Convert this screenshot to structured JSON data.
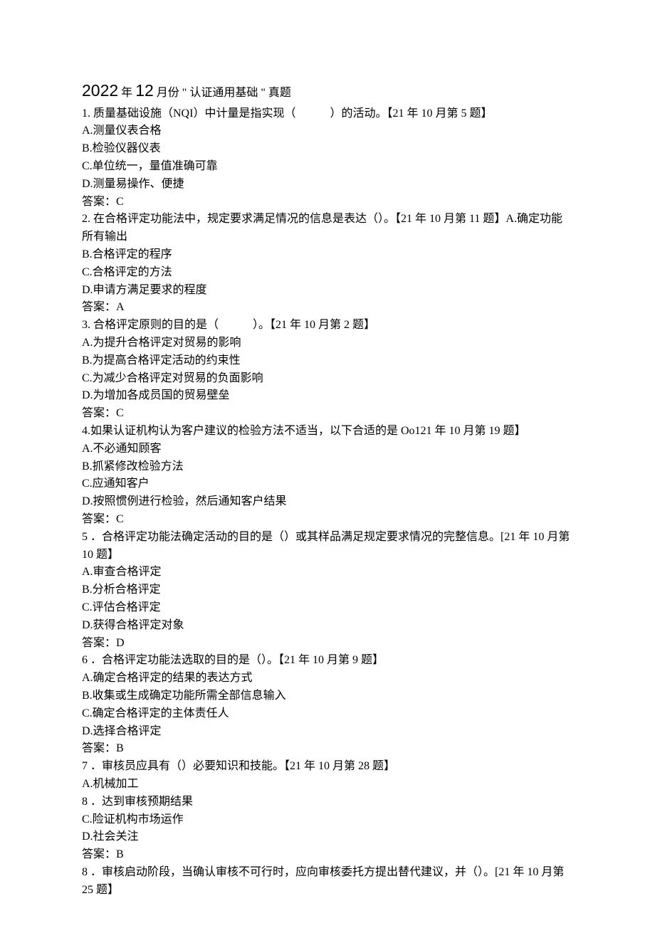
{
  "title": {
    "year": "2022",
    "year_suffix": " 年 ",
    "month": "12",
    "month_suffix": " 月份 \" 认证通用基础 \" 真题"
  },
  "questions": [
    {
      "stem": "1. 质量基础设施（NQI）中计量是指实现（　　　）的活动。【21 年 10 月第 5 题】",
      "options": [
        "A.测量仪表合格",
        "B.检验仪器仪表",
        "C.单位统一，量值准确可靠",
        "D.测量易操作、便捷"
      ],
      "answer": "答案：C"
    },
    {
      "stem": "2. 在合格评定功能法中，规定要求满足情况的信息是表达（）。【21 年 10 月第 11 题】A.确定功能所有输出",
      "options": [
        "B.合格评定的程序",
        "C.合格评定的方法",
        "D.申请方满足要求的程度"
      ],
      "answer": "答案：A"
    },
    {
      "stem": "3. 合格评定原则的目的是（　　　）。【21 年 10 月第 2 题】",
      "options": [
        "A.为提升合格评定对贸易的影响",
        "B.为提高合格评定活动的约束性",
        "C.为减少合格评定对贸易的负面影响",
        "D.为增加各成员国的贸易壁垒"
      ],
      "answer": "答案：C"
    },
    {
      "stem": "4.如果认证机构认为客户建议的检验方法不适当，以下合适的是 Oo121 年 10 月第 19 题】",
      "options": [
        "A.不必通知顾客",
        "B.抓紧修改检验方法",
        "C.应通知客户",
        "D.按照惯例进行检验，然后通知客户结果"
      ],
      "answer": "答案：C"
    },
    {
      "stem": "5 ．合格评定功能法确定活动的目的是（）或其样品满足规定要求情况的完整信息。[21 年 10 月第 10 题】",
      "options": [
        "A.审查合格评定",
        "B.分析合格评定",
        "C.评估合格评定",
        "D.获得合格评定对象"
      ],
      "answer": "答案：D"
    },
    {
      "stem": "6 ．合格评定功能法选取的目的是（）。【21 年 10 月第 9 题】",
      "options": [
        "A.确定合格评定的结果的表达方式",
        "B.收集或生成确定功能所需全部信息输入",
        "C.确定合格评定的主体责任人",
        "D.选择合格评定"
      ],
      "answer": "答案：B"
    },
    {
      "stem": "7 ．审核员应具有（）必要知识和技能。【21 年 10 月第 28 题】",
      "options": [
        "A.机械加工",
        "8 ．达到审核预期结果",
        "C.险证机构市场运作",
        "D.社会关注"
      ],
      "answer": "答案：B"
    },
    {
      "stem": "8 ．审核启动阶段，当确认审核不可行时，应向审核委托方提出替代建议，并（）。[21 年 10 月第 25 题】",
      "options": [],
      "answer": ""
    }
  ]
}
